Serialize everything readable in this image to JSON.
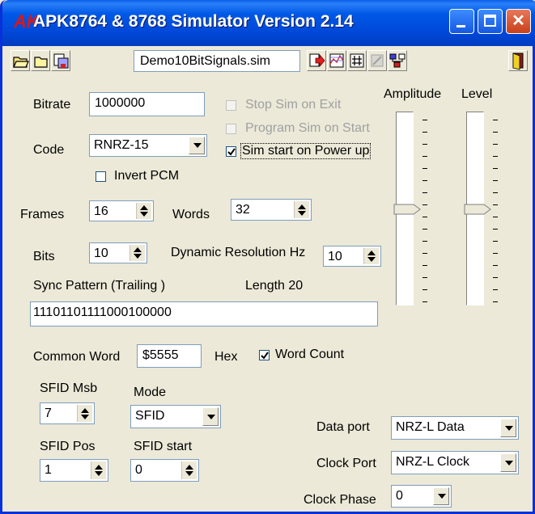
{
  "window": {
    "title": "APK8764 & 8768 Simulator Version 2.14",
    "app_logo": "AK"
  },
  "toolbar": {
    "filename": "Demo10BitSignals.sim",
    "icons": [
      "open-folder-icon",
      "folder-icon",
      "save-icon",
      "run-icon",
      "chart-icon",
      "grid-icon",
      "disabled-tool-icon",
      "network-icon",
      "exit-door-icon"
    ]
  },
  "form": {
    "bitrate": {
      "label": "Bitrate",
      "value": "1000000"
    },
    "code": {
      "label": "Code",
      "value": "RNRZ-15"
    },
    "invert_pcm": {
      "label": "Invert PCM",
      "checked": false
    },
    "stop_sim_on_exit": {
      "label": "Stop Sim on Exit",
      "checked": false,
      "enabled": false
    },
    "program_sim_on_start": {
      "label": "Program Sim on Start",
      "checked": false,
      "enabled": false
    },
    "sim_start_on_power_up": {
      "label": "Sim start on Power up",
      "checked": true
    },
    "frames": {
      "label": "Frames",
      "value": "16"
    },
    "words": {
      "label": "Words",
      "value": "32"
    },
    "bits": {
      "label": "Bits",
      "value": "10"
    },
    "dynamic_resolution": {
      "label": "Dynamic Resolution Hz",
      "value": "10"
    },
    "sync_pattern": {
      "label": "Sync Pattern (Trailing )",
      "length_label": "Length 20",
      "value": "11101101111000100000"
    },
    "common_word": {
      "label": "Common Word",
      "value": "$5555",
      "hex_label": "Hex"
    },
    "word_count": {
      "label": "Word Count",
      "checked": true
    },
    "sfid_msb": {
      "label": "SFID Msb",
      "value": "7"
    },
    "mode": {
      "label": "Mode",
      "value": "SFID"
    },
    "sfid_pos": {
      "label": "SFID Pos",
      "value": "1"
    },
    "sfid_start": {
      "label": "SFID start",
      "value": "0"
    },
    "data_port": {
      "label": "Data port",
      "value": "NRZ-L Data"
    },
    "clock_port": {
      "label": "Clock Port",
      "value": "NRZ-L Clock"
    },
    "clock_phase": {
      "label": "Clock Phase",
      "value": "0"
    }
  },
  "sliders": {
    "amplitude": {
      "label": "Amplitude",
      "level": 0.5
    },
    "level": {
      "label": "Level",
      "level": 0.5
    }
  }
}
